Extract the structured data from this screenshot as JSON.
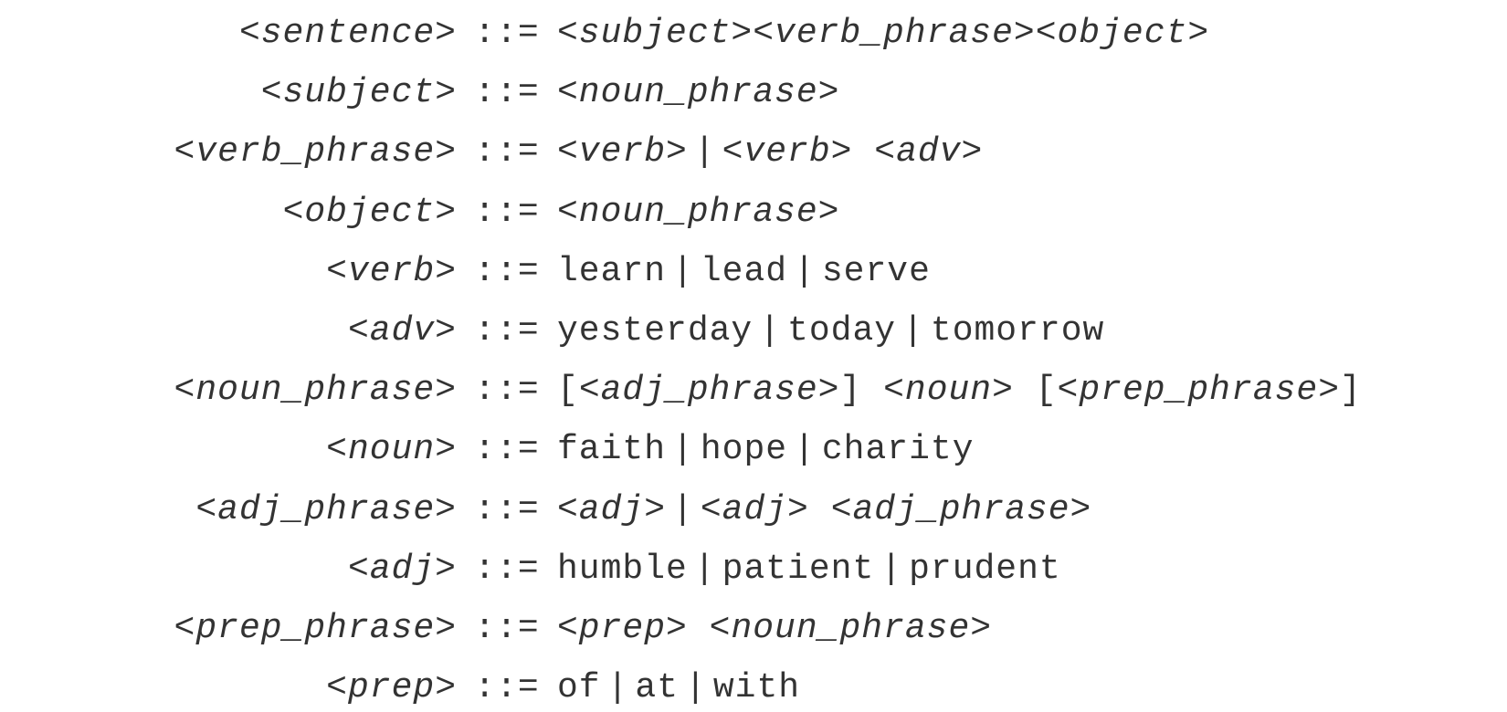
{
  "grammar": {
    "op": "::=",
    "rules": [
      {
        "lhs": "sentence",
        "rhs": [
          {
            "kind": "nt",
            "text": "subject"
          },
          {
            "kind": "nt",
            "text": "verb_phrase"
          },
          {
            "kind": "nt",
            "text": "object"
          }
        ]
      },
      {
        "lhs": "subject",
        "rhs": [
          {
            "kind": "nt",
            "text": "noun_phrase"
          }
        ]
      },
      {
        "lhs": "verb_phrase",
        "rhs": [
          {
            "kind": "nt",
            "text": "verb"
          },
          {
            "kind": "sep",
            "text": "|"
          },
          {
            "kind": "nt",
            "text": "verb"
          },
          {
            "kind": "sp"
          },
          {
            "kind": "nt",
            "text": "adv"
          }
        ]
      },
      {
        "lhs": "object",
        "rhs": [
          {
            "kind": "nt",
            "text": "noun_phrase"
          }
        ]
      },
      {
        "lhs": "verb",
        "rhs": [
          {
            "kind": "t",
            "text": "learn"
          },
          {
            "kind": "sep",
            "text": "|"
          },
          {
            "kind": "t",
            "text": "lead"
          },
          {
            "kind": "sep",
            "text": "|"
          },
          {
            "kind": "t",
            "text": "serve"
          }
        ]
      },
      {
        "lhs": "adv",
        "rhs": [
          {
            "kind": "t",
            "text": "yesterday"
          },
          {
            "kind": "sep",
            "text": "|"
          },
          {
            "kind": "t",
            "text": "today"
          },
          {
            "kind": "sep",
            "text": "|"
          },
          {
            "kind": "t",
            "text": "tomorrow"
          }
        ]
      },
      {
        "lhs": "noun_phrase",
        "rhs": [
          {
            "kind": "t",
            "text": "["
          },
          {
            "kind": "nt",
            "text": "adj_phrase"
          },
          {
            "kind": "t",
            "text": "]"
          },
          {
            "kind": "sp"
          },
          {
            "kind": "nt",
            "text": "noun"
          },
          {
            "kind": "sp"
          },
          {
            "kind": "t",
            "text": "["
          },
          {
            "kind": "nt",
            "text": "prep_phrase"
          },
          {
            "kind": "t",
            "text": "]"
          }
        ]
      },
      {
        "lhs": "noun",
        "rhs": [
          {
            "kind": "t",
            "text": "faith"
          },
          {
            "kind": "sep",
            "text": "|"
          },
          {
            "kind": "t",
            "text": "hope"
          },
          {
            "kind": "sep",
            "text": "|"
          },
          {
            "kind": "t",
            "text": "charity"
          }
        ]
      },
      {
        "lhs": "adj_phrase",
        "rhs": [
          {
            "kind": "nt",
            "text": "adj"
          },
          {
            "kind": "sep",
            "text": "|"
          },
          {
            "kind": "nt",
            "text": "adj"
          },
          {
            "kind": "sp"
          },
          {
            "kind": "nt",
            "text": "adj_phrase"
          }
        ]
      },
      {
        "lhs": "adj",
        "rhs": [
          {
            "kind": "t",
            "text": "humble"
          },
          {
            "kind": "sep",
            "text": "|"
          },
          {
            "kind": "t",
            "text": "patient"
          },
          {
            "kind": "sep",
            "text": "|"
          },
          {
            "kind": "t",
            "text": "prudent"
          }
        ]
      },
      {
        "lhs": "prep_phrase",
        "rhs": [
          {
            "kind": "nt",
            "text": "prep"
          },
          {
            "kind": "sp"
          },
          {
            "kind": "nt",
            "text": "noun_phrase"
          }
        ]
      },
      {
        "lhs": "prep",
        "rhs": [
          {
            "kind": "t",
            "text": "of"
          },
          {
            "kind": "sep",
            "text": "|"
          },
          {
            "kind": "t",
            "text": "at"
          },
          {
            "kind": "sep",
            "text": "|"
          },
          {
            "kind": "t",
            "text": "with"
          }
        ]
      }
    ]
  }
}
